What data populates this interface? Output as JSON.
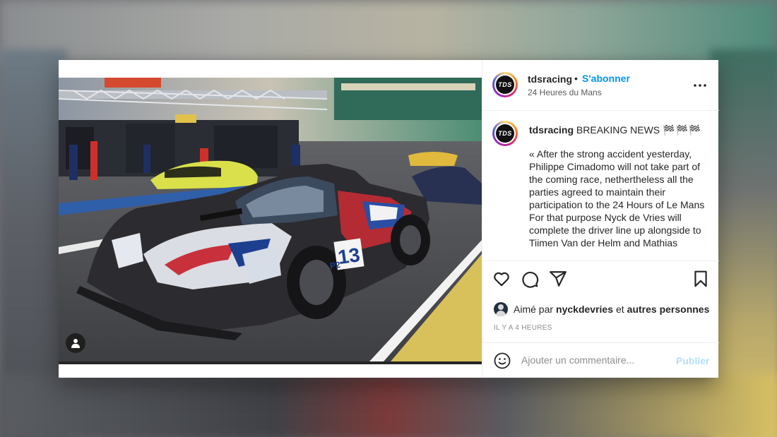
{
  "post": {
    "username": "tdsracing",
    "separator": "•",
    "follow_label": "S'abonner",
    "location": "24 Heures du Mans",
    "avatar_text": "TDS",
    "caption": {
      "username": "tdsracing",
      "headline": "BREAKING NEWS",
      "flags": "🏁🏁🏁",
      "body_lines": [
        "« After the strong accident yesterday, Philippe Cimadomo will not take part of the coming race, nethertheless all the parties agreed to maintain their participation to the 24 Hours of Le Mans",
        "For that purpose Nyck de Vries will complete the driver line up alongside to Tiimen Van der Helm and Mathias"
      ]
    },
    "likes": {
      "prefix": "Aimé par",
      "user": "nyckdevries",
      "conjunction": "et",
      "others": "autres personnes"
    },
    "timestamp": "IL Y A 4 HEURES",
    "comment": {
      "placeholder": "Ajouter un commentaire...",
      "publish_label": "Publier"
    },
    "image": {
      "car_number": "13",
      "class_label": "P2"
    }
  },
  "icons": {
    "header_more": "more-horizontal-icon",
    "like": "heart-icon",
    "comment": "comment-icon",
    "share": "send-icon",
    "save": "bookmark-icon",
    "emoji": "emoji-icon",
    "tagged": "user-tag-icon"
  },
  "colors": {
    "link_blue": "#0095f6",
    "publish_disabled": "#b2dffc",
    "text": "#262626",
    "muted": "#8e8e8e"
  }
}
